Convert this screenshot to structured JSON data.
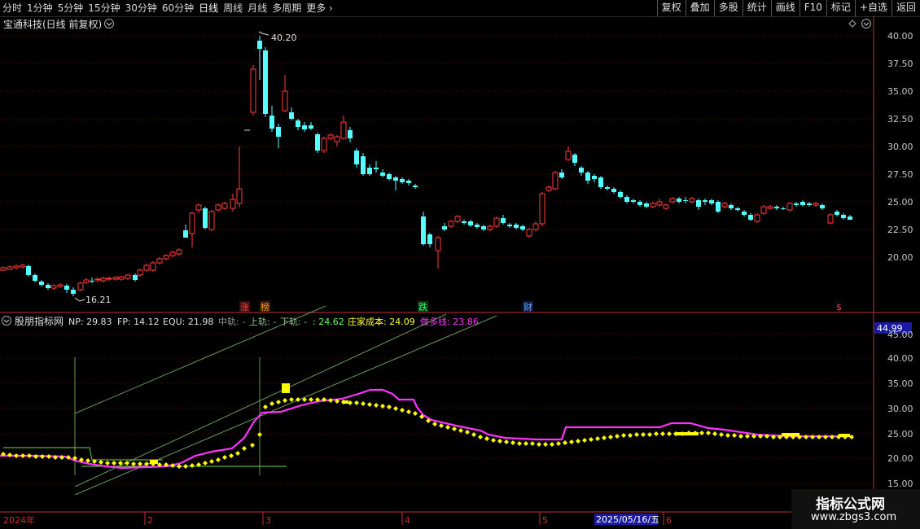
{
  "tabs": [
    "分时",
    "1分钟",
    "5分钟",
    "15分钟",
    "30分钟",
    "60分钟",
    "日线",
    "周线",
    "月线",
    "多周期",
    "更多"
  ],
  "active_tab": "日线",
  "right_tools": [
    "复权",
    "叠加",
    "多股",
    "统计",
    "画线",
    "F10",
    "标记",
    "+自选",
    "返回"
  ],
  "stock_title": "宝通科技(日线 前复权)",
  "main_axis": [
    "40.00",
    "37.50",
    "35.00",
    "32.50",
    "30.00",
    "27.50",
    "25.00",
    "22.50",
    "20.00"
  ],
  "high_label": "40.20",
  "low_label": "16.21",
  "event_markers": [
    "涨",
    "榜",
    "跌",
    "财",
    "$"
  ],
  "indicator": {
    "name": "股朋指标网",
    "np": "NP: 29.83",
    "fp": "FP: 14.12",
    "equ": "EQU: 21.98",
    "mid_rail": "中轨: -",
    "up_rail": "上轨: -",
    "down_rail": "下轨: -",
    "colon_value": ": 24.62",
    "dealer_cost": "庄家成本: 24.09",
    "long_short": "做多线: 23.86"
  },
  "sub_axis": [
    "45.00",
    "40.00",
    "35.00",
    "30.00",
    "25.00",
    "20.00",
    "15.00"
  ],
  "sub_axis_highlight": "44.99",
  "date_axis": [
    "2024年",
    "2",
    "3",
    "4",
    "5",
    "6"
  ],
  "date_highlight": "2025/05/16/五",
  "watermark": {
    "title": "指标公式网",
    "url": "www.zbgs3.com"
  },
  "colors": {
    "up": "#ff3b3b",
    "down": "#54ffff",
    "magenta": "#ff33ff",
    "yellow": "#ffff00",
    "grid": "#7a0000",
    "axis": "#c03030"
  }
}
